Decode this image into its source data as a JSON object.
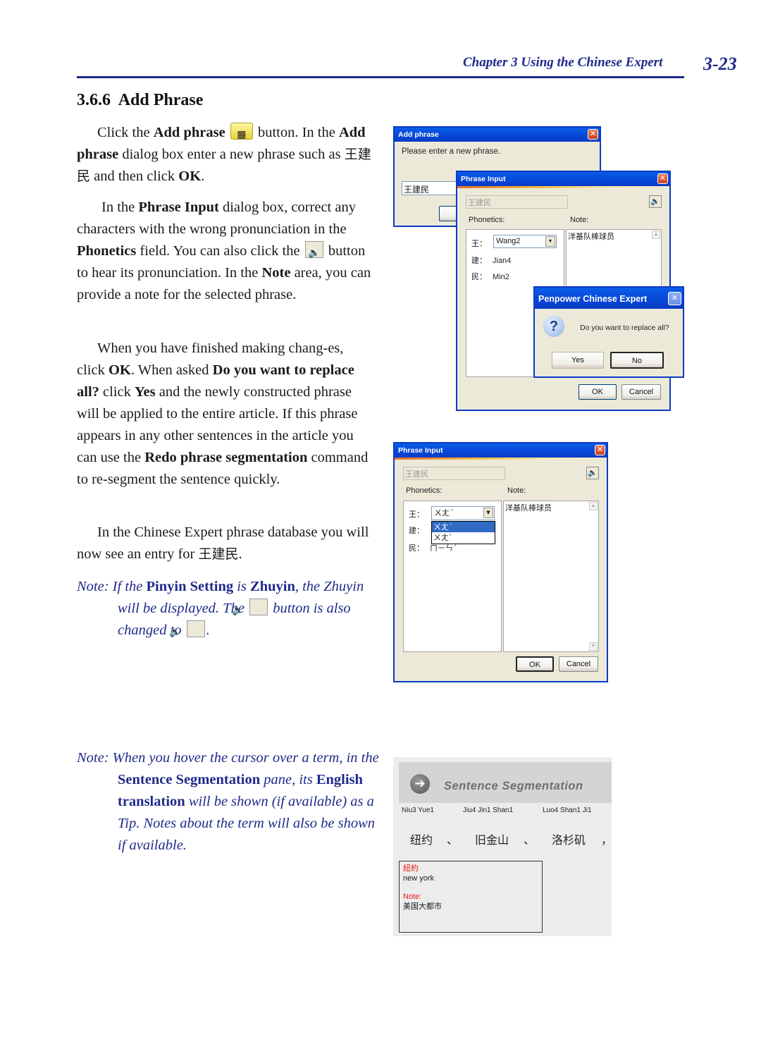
{
  "header": {
    "chapter": "Chapter 3  Using the Chinese Expert",
    "page_number": "3-23",
    "color": "#1f2a8a"
  },
  "section": {
    "number": "3.6.6",
    "title": "Add Phrase"
  },
  "body": {
    "p1": {
      "t1": "Click the ",
      "b1": "Add phrase",
      "t2": " button. In the",
      "b2": "Add phrase",
      "t3": " dialog box enter a new phrase such as ",
      "cjk": "王建民",
      "t4": " and then click ",
      "b3": "OK",
      "t5": "."
    },
    "p2": {
      "t1": "In the ",
      "b1": "Phrase Input",
      "t2": " dialog box, correct any characters with the wrong pronunciation in the ",
      "b2": "Phonetics",
      "t3": " field. You can also click the ",
      "t4": " button to hear its pronunciation. In the ",
      "b3": "Note",
      "t5": " area, you can provide a note for the selected phrase."
    },
    "p3": {
      "t1": "When you have finished making chang-es, click ",
      "b1": "OK",
      "t2": ". When asked ",
      "b2": "Do you want to replace all?",
      "t3": " click ",
      "b3": "Yes",
      "t4": " and the newly constructed phrase will be applied to the entire article. If this phrase appears in any other sentences in the article you can use the ",
      "b4": "Redo phrase segmentation",
      "t5": " command to re-segment the sentence quickly."
    },
    "p4": {
      "t1": "In the Chinese Expert phrase database you will now see an entry for ",
      "cjk": "王建民",
      "t2": "."
    }
  },
  "notes": {
    "note1": {
      "label": "Note: ",
      "t1": "If the ",
      "b1": "Pinyin Setting",
      "t2": " is ",
      "b2": "Zhuyin",
      "t3": ", the Zhuyin will be displayed. The ",
      "t4": " button is also changed to ",
      "t5": "."
    },
    "note2": {
      "label": "Note: ",
      "t1": "When you hover the cursor over a term, in the ",
      "b1": "Sentence Segmentation",
      "t2": " pane, its ",
      "b2": "English translation",
      "t3": " will be shown (if available) as a Tip. Notes about  the term will also be shown if available."
    }
  },
  "add_phrase_dialog": {
    "title": "Add phrase",
    "prompt": "Please enter a new phrase.",
    "input_value": "王建民"
  },
  "phrase_input_dialog": {
    "title": "Phrase Input",
    "phrase_value": "王建民",
    "phonetics_label": "Phonetics:",
    "note_label": "Note:",
    "rows": [
      {
        "char": "王：",
        "value": "Wang2"
      },
      {
        "char": "建：",
        "value": "Jian4"
      },
      {
        "char": "民：",
        "value": "Min2"
      }
    ],
    "note_value": "洋基队棒球员",
    "ok_label": "OK",
    "cancel_label": "Cancel"
  },
  "confirm_dialog": {
    "title": "Penpower Chinese Expert",
    "message": "Do you want to replace all?",
    "yes_label": "Yes",
    "no_label": "No"
  },
  "phrase_input_zhuyin": {
    "title": "Phrase Input",
    "phrase_value": "王建民",
    "phonetics_label": "Phonetics:",
    "note_label": "Note:",
    "rows": [
      {
        "char": "王：",
        "value": "ㄨㄤˊ"
      },
      {
        "char": "建：",
        "value": ""
      },
      {
        "char": "民：",
        "value": "ㄇㄧㄣˊ"
      }
    ],
    "dropdown_options": [
      "ㄨㄤˊ",
      "ㄨㄤˋ"
    ],
    "dropdown_selected_index": 0,
    "note_value": "洋基队棒球员",
    "ok_label": "OK",
    "cancel_label": "Cancel"
  },
  "sentence_segmentation": {
    "title": "Sentence Segmentation",
    "terms": [
      {
        "pinyin": "Niu3 Yue1",
        "word": "纽约"
      },
      {
        "pinyin": "Jiu4 Jin1 Shan1",
        "word": "旧金山"
      },
      {
        "pinyin": "Luo4 Shan1 Ji1",
        "word": "洛杉矶"
      }
    ],
    "separators": [
      "、",
      "、",
      "，"
    ],
    "tip": {
      "term": "紐約",
      "translation": "new york",
      "note_label": "Note:",
      "note_value": "美国大都市"
    }
  }
}
